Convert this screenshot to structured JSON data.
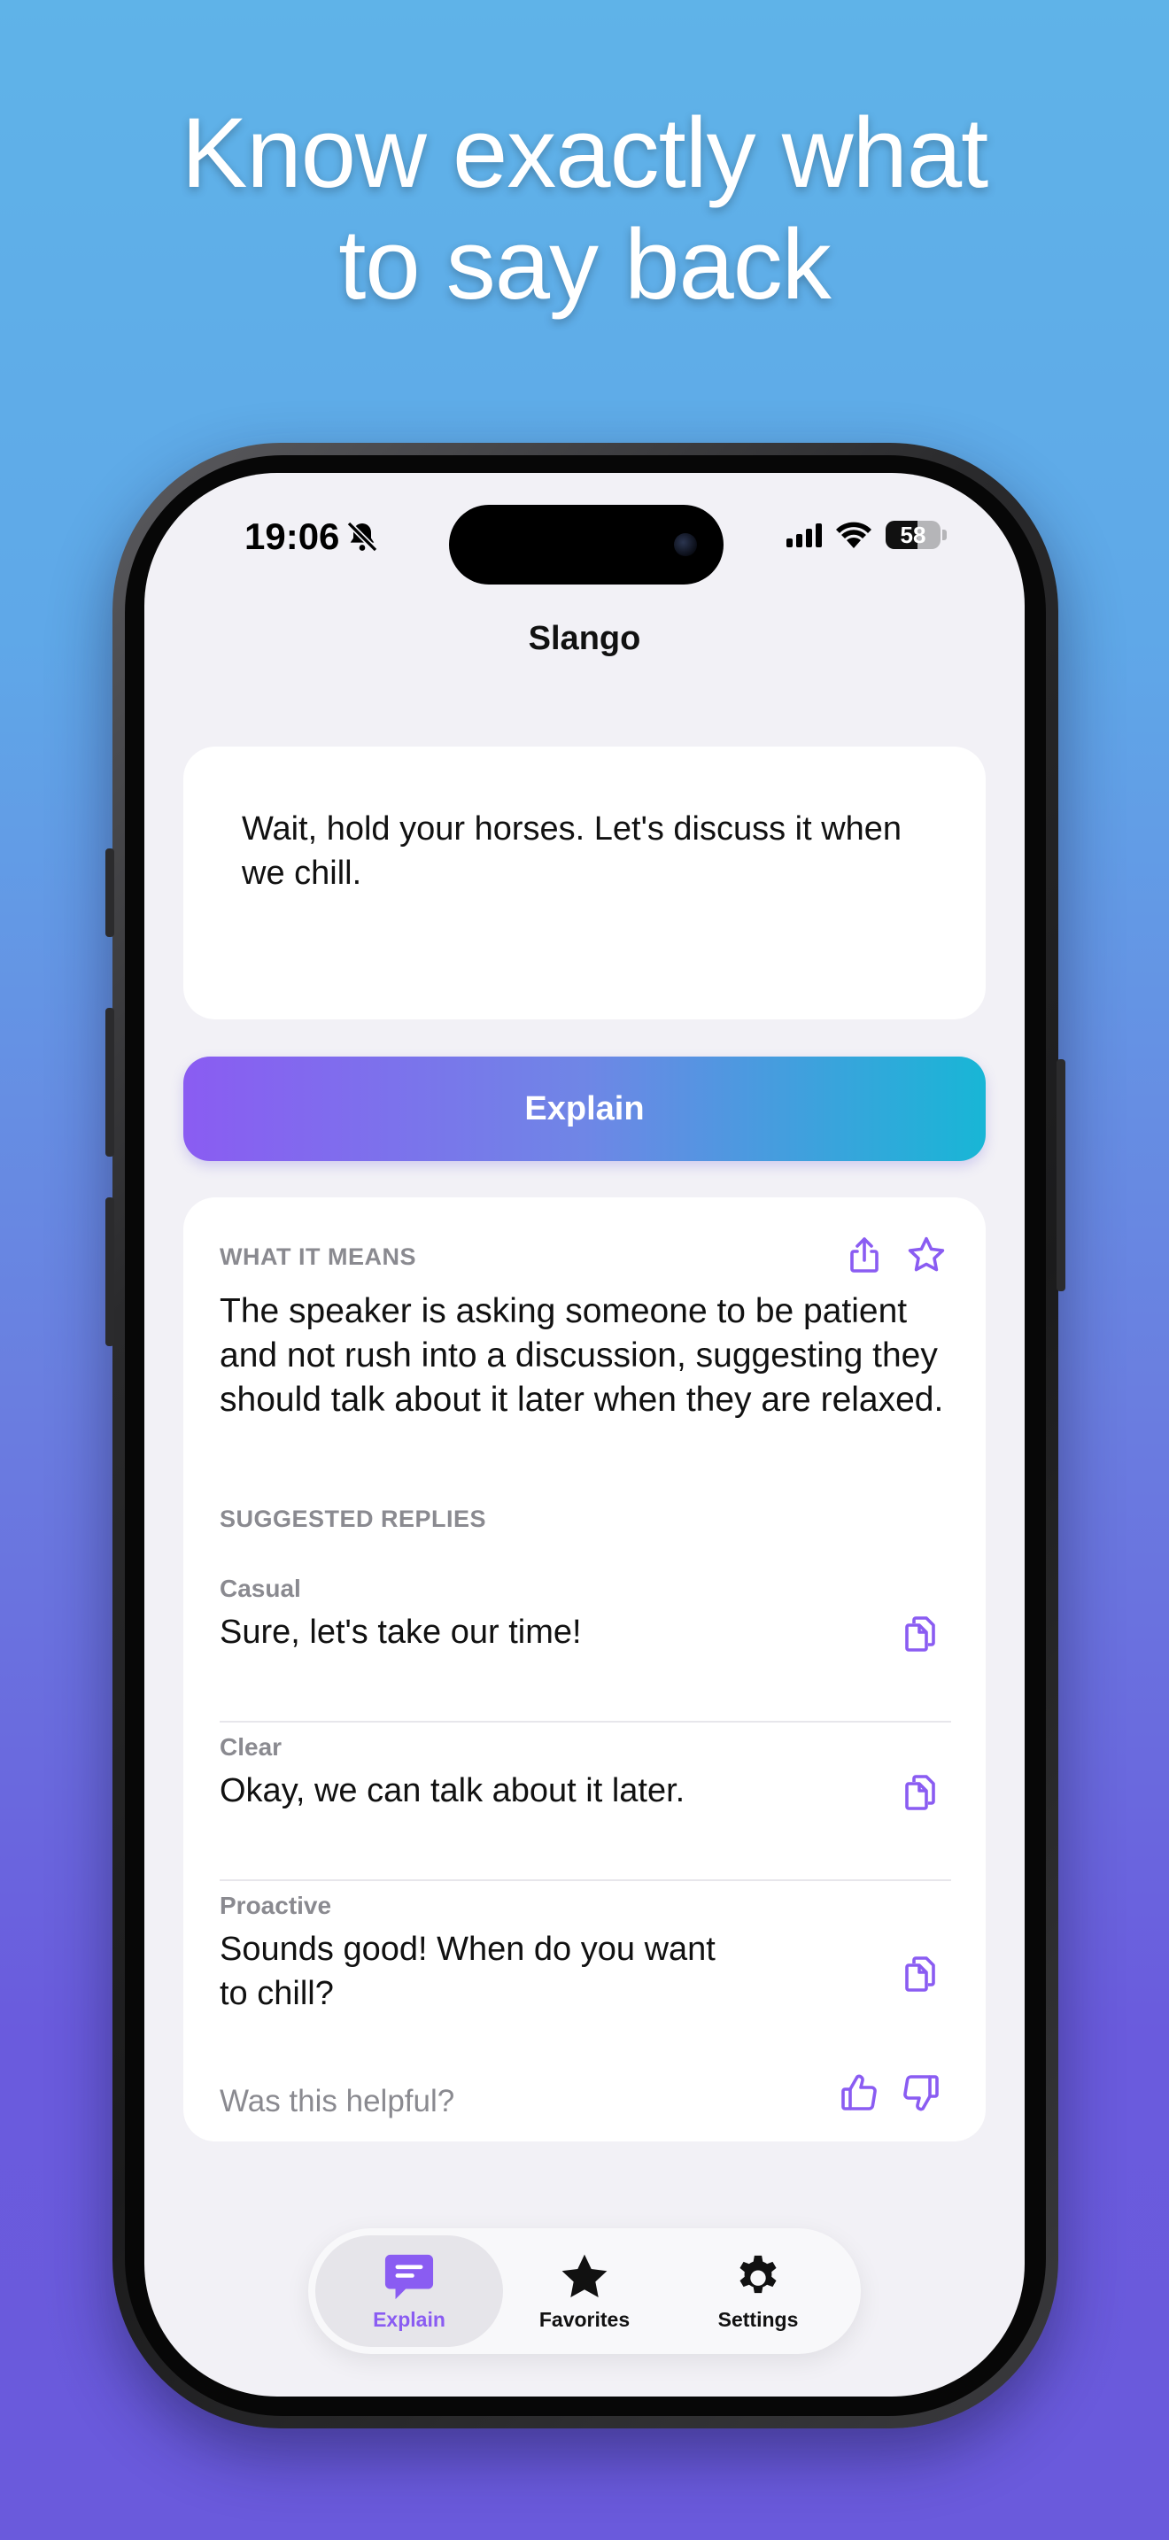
{
  "headline": {
    "line1": "Know exactly what",
    "line2": "to say back"
  },
  "status_bar": {
    "time": "19:06",
    "battery": "58"
  },
  "nav": {
    "title": "Slango"
  },
  "input": {
    "text": "Wait, hold your horses. Let's discuss it when we chill."
  },
  "explain_button": {
    "label": "Explain"
  },
  "result": {
    "meaning_label": "WHAT IT MEANS",
    "meaning": "The speaker is asking someone to be patient and not rush into a discussion, suggesting they should talk about it later when they are relaxed.",
    "replies_label": "SUGGESTED REPLIES",
    "replies": [
      {
        "tone": "Casual",
        "text": "Sure, let's take our time!"
      },
      {
        "tone": "Clear",
        "text": "Okay, we can talk about it later."
      },
      {
        "tone": "Proactive",
        "text": "Sounds good! When do you want to chill?"
      }
    ],
    "helpful_prompt": "Was this helpful?"
  },
  "tabs": [
    {
      "label": "Explain",
      "icon": "message-icon",
      "active": true
    },
    {
      "label": "Favorites",
      "icon": "star-icon",
      "active": false
    },
    {
      "label": "Settings",
      "icon": "gear-icon",
      "active": false
    }
  ],
  "colors": {
    "accent": "#8a5cf2",
    "gradient_end": "#18b6d6",
    "background": "#f2f1f6"
  }
}
